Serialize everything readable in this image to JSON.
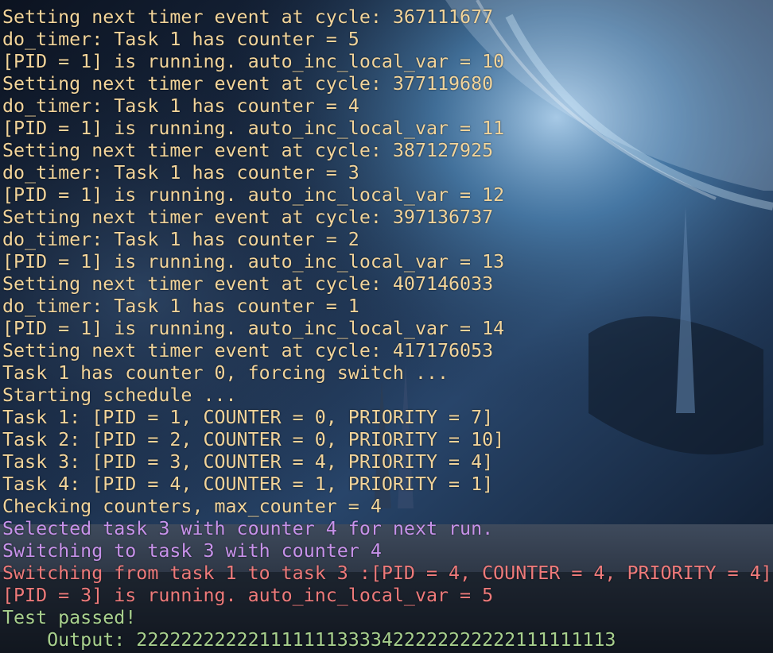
{
  "colors": {
    "default": "#f2d49a",
    "magenta": "#c792ea",
    "red": "#ee7a7a",
    "green": "#a8d08d"
  },
  "terminal": {
    "lines": [
      {
        "text": "Setting next timer event at cycle: 367111677",
        "color": "default"
      },
      {
        "text": "do_timer: Task 1 has counter = 5",
        "color": "default"
      },
      {
        "text": "[PID = 1] is running. auto_inc_local_var = 10",
        "color": "default"
      },
      {
        "text": "Setting next timer event at cycle: 377119680",
        "color": "default"
      },
      {
        "text": "do_timer: Task 1 has counter = 4",
        "color": "default"
      },
      {
        "text": "[PID = 1] is running. auto_inc_local_var = 11",
        "color": "default"
      },
      {
        "text": "Setting next timer event at cycle: 387127925",
        "color": "default"
      },
      {
        "text": "do_timer: Task 1 has counter = 3",
        "color": "default"
      },
      {
        "text": "[PID = 1] is running. auto_inc_local_var = 12",
        "color": "default"
      },
      {
        "text": "Setting next timer event at cycle: 397136737",
        "color": "default"
      },
      {
        "text": "do_timer: Task 1 has counter = 2",
        "color": "default"
      },
      {
        "text": "[PID = 1] is running. auto_inc_local_var = 13",
        "color": "default"
      },
      {
        "text": "Setting next timer event at cycle: 407146033",
        "color": "default"
      },
      {
        "text": "do_timer: Task 1 has counter = 1",
        "color": "default"
      },
      {
        "text": "[PID = 1] is running. auto_inc_local_var = 14",
        "color": "default"
      },
      {
        "text": "Setting next timer event at cycle: 417176053",
        "color": "default"
      },
      {
        "text": "Task 1 has counter 0, forcing switch ...",
        "color": "default"
      },
      {
        "text": "Starting schedule ...",
        "color": "default"
      },
      {
        "text": "Task 1: [PID = 1, COUNTER = 0, PRIORITY = 7]",
        "color": "default"
      },
      {
        "text": "Task 2: [PID = 2, COUNTER = 0, PRIORITY = 10]",
        "color": "default"
      },
      {
        "text": "Task 3: [PID = 3, COUNTER = 4, PRIORITY = 4]",
        "color": "default"
      },
      {
        "text": "Task 4: [PID = 4, COUNTER = 1, PRIORITY = 1]",
        "color": "default"
      },
      {
        "text": "Checking counters, max_counter = 4",
        "color": "default"
      },
      {
        "text": "Selected task 3 with counter 4 for next run.",
        "color": "magenta"
      },
      {
        "text": "Switching to task 3 with counter 4",
        "color": "magenta"
      },
      {
        "text": "Switching from task 1 to task 3 :[PID = 4, COUNTER = 4, PRIORITY = 4]",
        "color": "red"
      },
      {
        "text": "[PID = 3] is running. auto_inc_local_var = 5",
        "color": "red"
      },
      {
        "text": "Test passed!",
        "color": "green"
      },
      {
        "text": "    Output: 2222222222211111113333422222222222111111113",
        "color": "green"
      }
    ]
  }
}
